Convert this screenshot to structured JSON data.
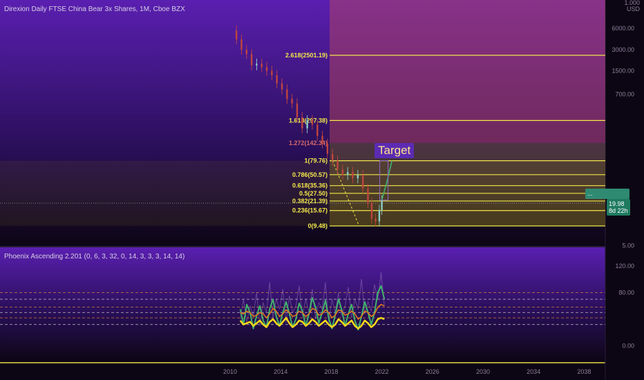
{
  "app": {
    "instrument_title": "Direxion Daily FTSE China Bear 3x Shares, 1M, Cboe BZX",
    "indicator_title": "Phoenix Ascending 2.201 (0, 6, 3, 32, 0, 14, 3, 3, 3, 14, 14)",
    "currency": "USD",
    "scale_note": "1.000"
  },
  "colors": {
    "background_top": "#0c0614",
    "background_purple": "#5a1fb0",
    "fib_line": "#f3e84a",
    "fib_zone": "#8a7a14",
    "target_zone": "#c24a5a",
    "candle_up": "#8ad0c8",
    "candle_down": "#c0453d",
    "osc_green": "#3fb36c",
    "osc_orange": "#e07a1f",
    "osc_yellow": "#f2d61a",
    "osc_purple": "#c9a6e8",
    "level_orange": "#e0873a",
    "level_white": "#cccccc"
  },
  "annotations": {
    "target_label": "Target",
    "price_label": "19.98",
    "countdown_label": "8d 22h",
    "marker_label": "..."
  },
  "chart_data": [
    {
      "type": "candlestick",
      "title": "Direxion Daily FTSE China Bear 3x Shares, 1M, Cboe BZX",
      "scale": "log",
      "y_ticks": [
        "6000.00",
        "3000.00",
        "1500.00",
        "700.00",
        "",
        "",
        "",
        "",
        "",
        "",
        "5.00"
      ],
      "x_ticks": [
        "2010",
        "2014",
        "2018",
        "2022",
        "2026",
        "2030",
        "2034",
        "2038"
      ],
      "fib_levels": [
        {
          "ratio": "2.618",
          "value": 2501.19,
          "label": "2.618(2501.19)"
        },
        {
          "ratio": "1.618",
          "value": 297.38,
          "label": "1.618(297.38)"
        },
        {
          "ratio": "1.272",
          "value": 142.34,
          "label": "1.272(142.34)"
        },
        {
          "ratio": "1",
          "value": 79.76,
          "label": "1(79.76)"
        },
        {
          "ratio": "0.786",
          "value": 50.57,
          "label": "0.786(50.57)"
        },
        {
          "ratio": "0.618",
          "value": 35.36,
          "label": "0.618(35.36)"
        },
        {
          "ratio": "0.5",
          "value": 27.5,
          "label": "0.5(27.50)"
        },
        {
          "ratio": "0.382",
          "value": 21.39,
          "label": "0.382(21.39)"
        },
        {
          "ratio": "0.236",
          "value": 15.67,
          "label": "0.236(15.67)"
        },
        {
          "ratio": "0",
          "value": 9.48,
          "label": "0(9.48)"
        }
      ],
      "last_price": 19.98,
      "series_close": [
        {
          "x": 2010.1,
          "y": 5600
        },
        {
          "x": 2010.5,
          "y": 4200
        },
        {
          "x": 2010.9,
          "y": 3000
        },
        {
          "x": 2011.3,
          "y": 2600
        },
        {
          "x": 2011.7,
          "y": 1800
        },
        {
          "x": 2012.1,
          "y": 1900
        },
        {
          "x": 2012.5,
          "y": 1700
        },
        {
          "x": 2012.9,
          "y": 1500
        },
        {
          "x": 2013.3,
          "y": 1300
        },
        {
          "x": 2013.7,
          "y": 1000
        },
        {
          "x": 2014.1,
          "y": 820
        },
        {
          "x": 2014.5,
          "y": 600
        },
        {
          "x": 2014.9,
          "y": 520
        },
        {
          "x": 2015.3,
          "y": 330
        },
        {
          "x": 2015.7,
          "y": 230
        },
        {
          "x": 2016.1,
          "y": 300
        },
        {
          "x": 2016.5,
          "y": 260
        },
        {
          "x": 2016.9,
          "y": 180
        },
        {
          "x": 2017.3,
          "y": 140
        },
        {
          "x": 2017.7,
          "y": 100
        },
        {
          "x": 2018.1,
          "y": 80
        },
        {
          "x": 2018.5,
          "y": 60
        },
        {
          "x": 2018.9,
          "y": 50
        },
        {
          "x": 2019.3,
          "y": 55
        },
        {
          "x": 2019.7,
          "y": 45
        },
        {
          "x": 2020.1,
          "y": 50
        },
        {
          "x": 2020.5,
          "y": 32
        },
        {
          "x": 2020.9,
          "y": 20
        },
        {
          "x": 2021.2,
          "y": 12
        },
        {
          "x": 2021.5,
          "y": 11
        },
        {
          "x": 2021.8,
          "y": 16
        },
        {
          "x": 2022.0,
          "y": 22
        }
      ],
      "projection": [
        {
          "x": 2022.0,
          "y": 22
        },
        {
          "x": 2022.4,
          "y": 40
        },
        {
          "x": 2022.8,
          "y": 80
        }
      ]
    },
    {
      "type": "line",
      "title": "Phoenix Ascending 2.201 (0, 6, 3, 32, 0, 14, 3, 3, 3, 14, 14)",
      "y_ticks": [
        "120.00",
        "80.00",
        "",
        "",
        "0.00"
      ],
      "ylim": [
        -15,
        125
      ],
      "levels": [
        80,
        70,
        58,
        50,
        42,
        32
      ],
      "series": [
        {
          "values": [
            55,
            32,
            62,
            50,
            26,
            45,
            60,
            38,
            28,
            55,
            70,
            44,
            30,
            50,
            66,
            48,
            28,
            40,
            64,
            52,
            30,
            48,
            72,
            58,
            34,
            50,
            68,
            42,
            26,
            46,
            70,
            54,
            30,
            48,
            62,
            38,
            24,
            44,
            66,
            50,
            32,
            50,
            80,
            90,
            70
          ]
        },
        {
          "values": [
            50,
            48,
            52,
            50,
            44,
            46,
            50,
            48,
            42,
            48,
            56,
            52,
            44,
            48,
            54,
            50,
            44,
            46,
            52,
            50,
            44,
            48,
            56,
            54,
            46,
            48,
            54,
            50,
            42,
            46,
            54,
            52,
            46,
            48,
            52,
            48,
            40,
            44,
            52,
            50,
            44,
            48,
            58,
            62,
            60
          ]
        },
        {
          "values": [
            38,
            32,
            34,
            36,
            30,
            34,
            38,
            32,
            28,
            36,
            40,
            34,
            30,
            36,
            42,
            34,
            28,
            32,
            38,
            36,
            30,
            34,
            40,
            36,
            30,
            34,
            38,
            32,
            28,
            32,
            40,
            36,
            30,
            34,
            38,
            30,
            26,
            30,
            38,
            34,
            28,
            32,
            40,
            42,
            40
          ]
        },
        {
          "values": [
            40,
            70,
            35,
            60,
            45,
            80,
            30,
            65,
            50,
            95,
            40,
            70,
            55,
            85,
            35,
            75,
            50,
            60,
            90,
            45,
            70,
            50,
            85,
            40,
            65,
            55,
            95,
            35,
            70,
            50,
            80,
            45,
            60,
            88,
            42,
            70,
            55,
            100,
            48,
            66,
            52,
            92,
            70,
            110,
            60
          ]
        }
      ]
    }
  ]
}
